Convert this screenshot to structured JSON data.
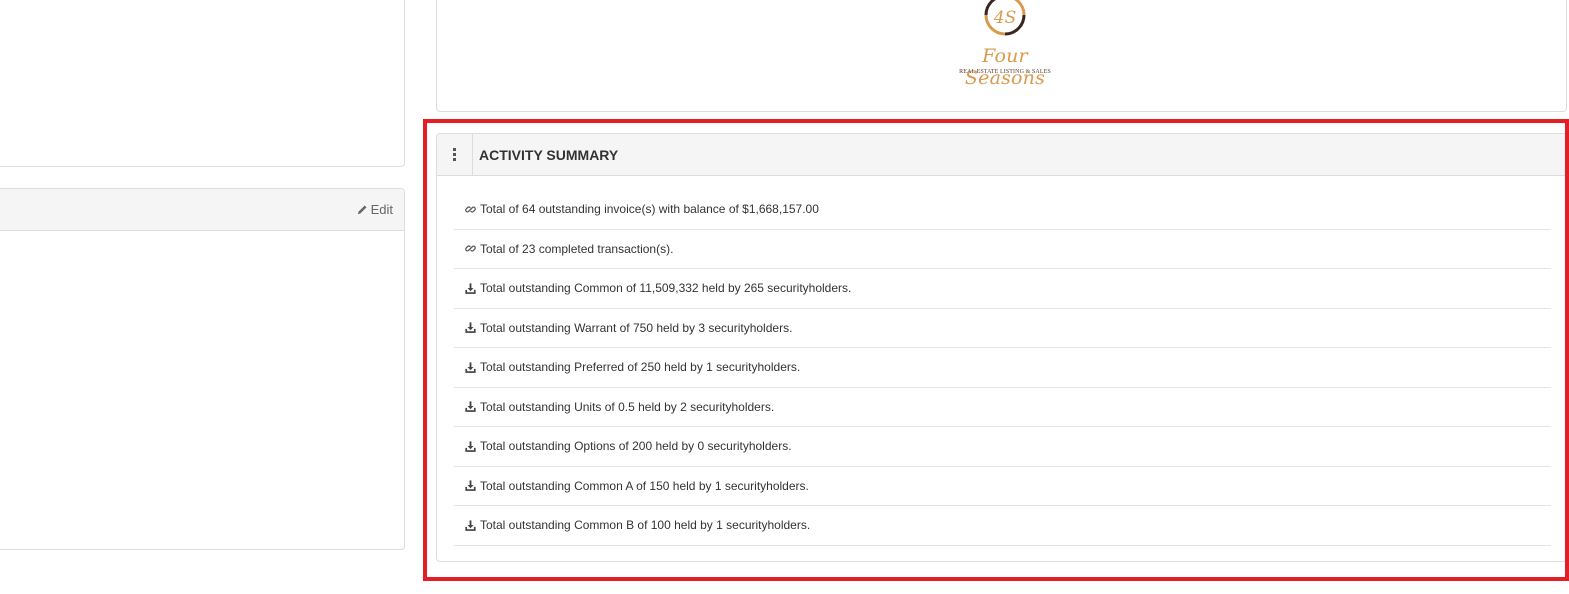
{
  "left_bottom_panel": {
    "edit_label": "Edit"
  },
  "logo": {
    "monogram": "4S",
    "name": "Four Seasons",
    "tagline": "REAL ESTATE LISTING & SALES",
    "colors": {
      "gold": "#d89a4e",
      "brown": "#3a2520"
    }
  },
  "highlight_color": "#e31e24",
  "activity_summary": {
    "title": "ACTIVITY SUMMARY",
    "items": [
      {
        "icon": "link-icon",
        "text": "Total of 64 outstanding invoice(s) with balance of $1,668,157.00"
      },
      {
        "icon": "link-icon",
        "text": "Total of 23 completed transaction(s)."
      },
      {
        "icon": "download-icon",
        "text": "Total outstanding Common of 11,509,332 held by 265 securityholders."
      },
      {
        "icon": "download-icon",
        "text": "Total outstanding Warrant of 750 held by 3 securityholders."
      },
      {
        "icon": "download-icon",
        "text": "Total outstanding Preferred of 250 held by 1 securityholders."
      },
      {
        "icon": "download-icon",
        "text": "Total outstanding Units of 0.5 held by 2 securityholders."
      },
      {
        "icon": "download-icon",
        "text": "Total outstanding Options of 200 held by 0 securityholders."
      },
      {
        "icon": "download-icon",
        "text": "Total outstanding Common A of 150 held by 1 securityholders."
      },
      {
        "icon": "download-icon",
        "text": "Total outstanding Common B of 100 held by 1 securityholders."
      }
    ]
  }
}
